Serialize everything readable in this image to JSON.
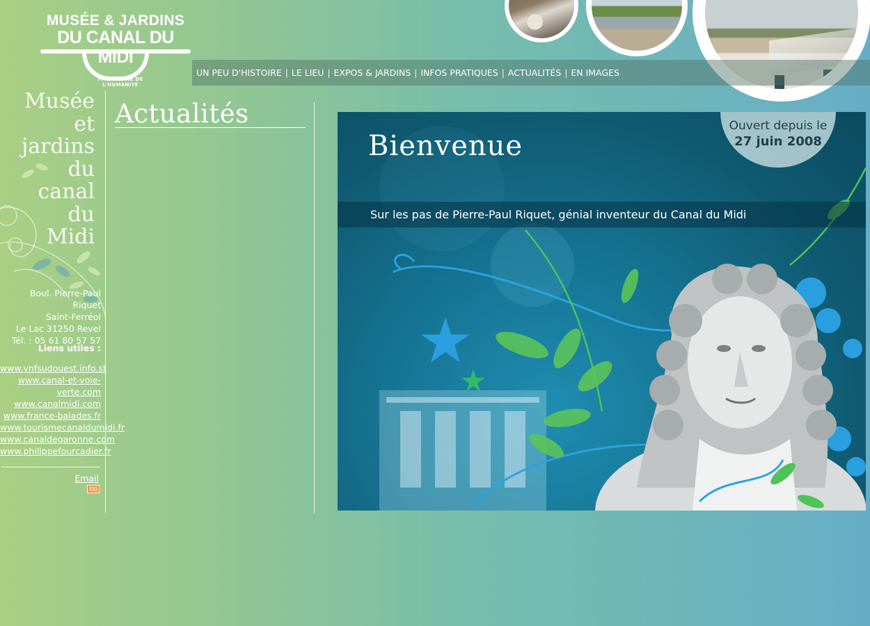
{
  "logo": {
    "line1": "MUSÉE & JARDINS",
    "line2": "DU CANAL DU MIDI",
    "subtitle": "PATRIMOINE DE L'HUMANITÉ"
  },
  "nav": {
    "items": [
      "UN PEU D'HISTOIRE",
      "LE LIEU",
      "EXPOS & JARDINS",
      "INFOS PRATIQUES",
      "ACTUALITÉS",
      "EN IMAGES"
    ]
  },
  "sidebar": {
    "title_lines": [
      "Musée",
      "et",
      "jardins",
      "du",
      "canal",
      "du",
      "Midi"
    ],
    "address": [
      "Boul. Pierre-Paul Riquet",
      "Saint-Ferréol",
      "Le Lac 31250 Revel",
      "Tél. : 05 61 80 57 57"
    ],
    "links_title": "Liens utiles :",
    "links": [
      "www.vnfsudouest.info.st",
      "www.canal-et-voie-verte.com",
      "www.canalmidi.com",
      "www.france-balades.fr",
      "www.tourismecanaldumidi.fr",
      "www.canaldegaronne.com",
      "www.philippefourcadier.fr"
    ],
    "email_label": "Email",
    "rss_label": "RSS"
  },
  "main": {
    "title": "Actualités"
  },
  "banner": {
    "welcome": "Bienvenue",
    "badge_line1": "Ouvert depuis le",
    "badge_line2": "27 juin 2008",
    "tagline": "Sur les pas de Pierre-Paul Riquet, génial inventeur du Canal du Midi"
  }
}
